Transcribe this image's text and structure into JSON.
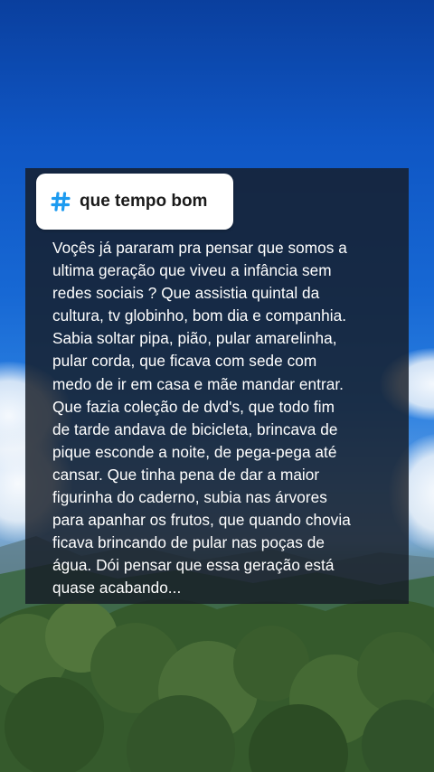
{
  "hashtag": {
    "icon": "hashtag-icon",
    "icon_color": "#1d9bf0",
    "text": "que tempo bom"
  },
  "post": {
    "lines": [
      "Voçês já pararam pra pensar que somos a",
      "ultima geração que viveu a infância sem",
      "redes sociais ? Que assistia quintal da",
      "cultura, tv globinho, bom dia e companhia.",
      "Sabia soltar pipa, pião, pular amarelinha,",
      "pular corda, que ficava com sede com",
      "medo de ir em casa e mãe mandar entrar.",
      "Que fazia coleção de dvd's, que todo fim",
      "de tarde andava de bicicleta, brincava de",
      "pique esconde a noite, de pega-pega até",
      "cansar. Que tinha pena de dar a maior",
      "figurinha do caderno, subia nas árvores",
      "para apanhar os frutos, que quando chovia",
      "ficava brincando de pular nas poças de",
      "água. Dói pensar que essa geração está",
      "quase acabando..."
    ]
  },
  "background": {
    "scene": "blue sky with clouds over mountains and forest"
  }
}
